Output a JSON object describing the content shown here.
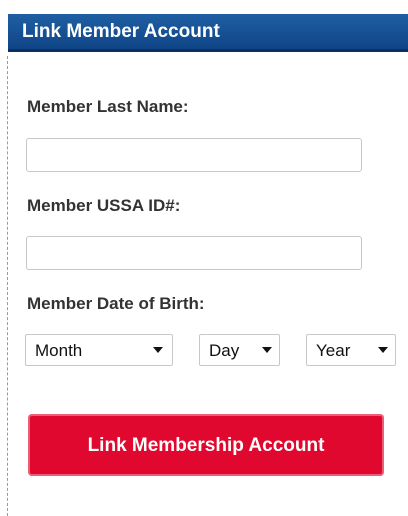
{
  "header": {
    "title": "Link Member Account"
  },
  "form": {
    "last_name": {
      "label": "Member Last Name:",
      "value": ""
    },
    "ussa_id": {
      "label": "Member USSA ID#:",
      "value": ""
    },
    "dob": {
      "label": "Member Date of Birth:",
      "month": "Month",
      "day": "Day",
      "year": "Year"
    },
    "submit_label": "Link Membership Account"
  },
  "colors": {
    "header_bg": "#1a5698",
    "button_bg": "#e0082e",
    "label_text": "#333333"
  },
  "icons": {
    "dropdown": "chevron-down-icon"
  }
}
